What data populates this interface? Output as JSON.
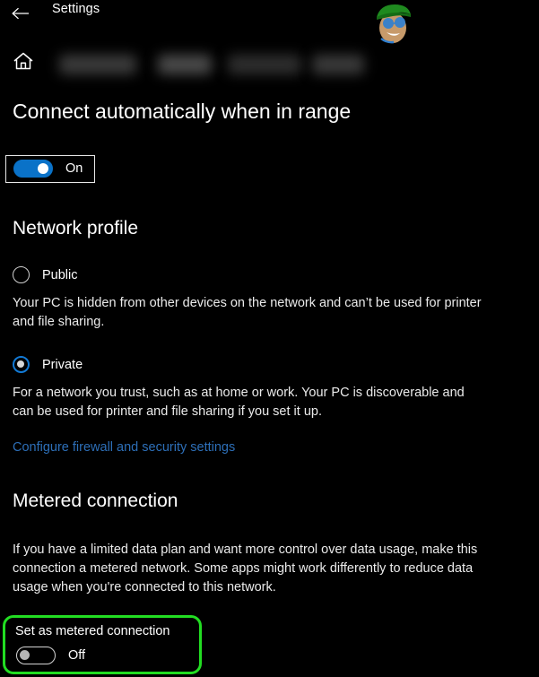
{
  "titlebar": {
    "back_label": "Back",
    "back_icon": "arrow-left-icon",
    "title": "Settings"
  },
  "header": {
    "home_icon": "home-icon",
    "breadcrumb_redacted": true
  },
  "watermark": {
    "name": "appuals-mascot-logo",
    "hat_color": "#1f8a1f",
    "glasses_color": "#2f7fd0",
    "skin_color": "#c79a6a"
  },
  "connect_automatically": {
    "heading": "Connect automatically when in range",
    "toggle": {
      "state": "on",
      "label": "On",
      "accent_color": "#0a72c8",
      "focused": true
    }
  },
  "network_profile": {
    "heading": "Network profile",
    "options": [
      {
        "label": "Public",
        "selected": false,
        "description": "Your PC is hidden from other devices on the network and can’t be used for printer and file sharing."
      },
      {
        "label": "Private",
        "selected": true,
        "description": "For a network you trust, such as at home or work. Your PC is discoverable and can be used for printer and file sharing if you set it up."
      }
    ],
    "link": {
      "label": "Configure firewall and security settings",
      "color": "#2d6fb8"
    }
  },
  "metered_connection": {
    "heading": "Metered connection",
    "description": "If you have a limited data plan and want more control over data usage, make this connection a metered network. Some apps might work differently to reduce data usage when you're connected to this network.",
    "setting": {
      "title": "Set as metered connection",
      "toggle": {
        "state": "off",
        "label": "Off"
      },
      "highlight_color": "#22dd22"
    }
  }
}
